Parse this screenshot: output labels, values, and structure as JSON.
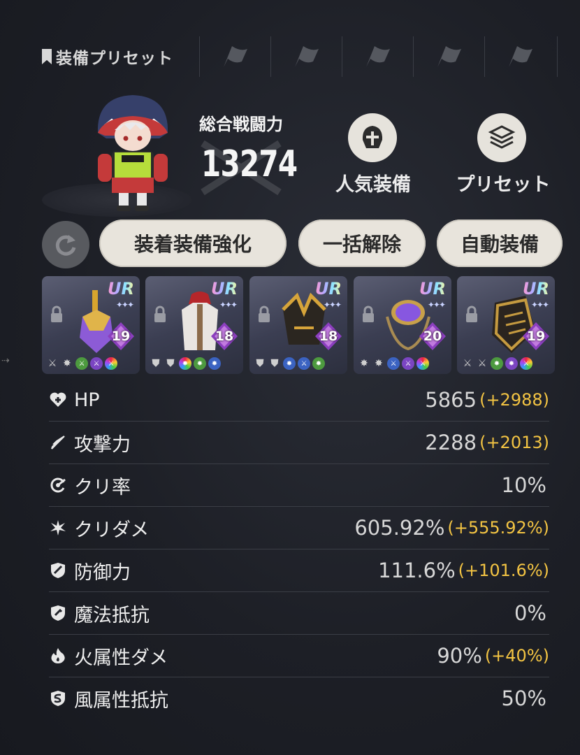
{
  "preset_bar": {
    "label": "装備プリセット",
    "slot_count": 5
  },
  "power": {
    "title": "総合戦闘力",
    "value": "13274"
  },
  "buttons": {
    "popular": "人気装備",
    "preset": "プリセット",
    "enhance": "装着装備強化",
    "unequip": "一括解除",
    "auto": "自動装備"
  },
  "equipment": [
    {
      "rarity": "UR",
      "level": "19",
      "item": "ornate-mace"
    },
    {
      "rarity": "UR",
      "level": "18",
      "item": "white-coat"
    },
    {
      "rarity": "UR",
      "level": "18",
      "item": "dark-helmet"
    },
    {
      "rarity": "UR",
      "level": "20",
      "item": "purple-amulet"
    },
    {
      "rarity": "UR",
      "level": "19",
      "item": "gauntlet"
    }
  ],
  "stats": [
    {
      "icon": "heart-plus-icon",
      "name": "HP",
      "value": "5865",
      "bonus": "(+2988)"
    },
    {
      "icon": "sword-icon",
      "name": "攻撃力",
      "value": "2288",
      "bonus": "(+2013)"
    },
    {
      "icon": "crit-rate-icon",
      "name": "クリ率",
      "value": "10%",
      "bonus": ""
    },
    {
      "icon": "crit-damage-icon",
      "name": "クリダメ",
      "value": "605.92%",
      "bonus": "(+555.92%)"
    },
    {
      "icon": "shield-icon",
      "name": "防御力",
      "value": "111.6%",
      "bonus": "(+101.6%)"
    },
    {
      "icon": "magic-resist-icon",
      "name": "魔法抵抗",
      "value": "0%",
      "bonus": ""
    },
    {
      "icon": "fire-icon",
      "name": "火属性ダメ",
      "value": "90%",
      "bonus": "(+40%)"
    },
    {
      "icon": "wind-resist-icon",
      "name": "風属性抵抗",
      "value": "50%",
      "bonus": ""
    }
  ]
}
